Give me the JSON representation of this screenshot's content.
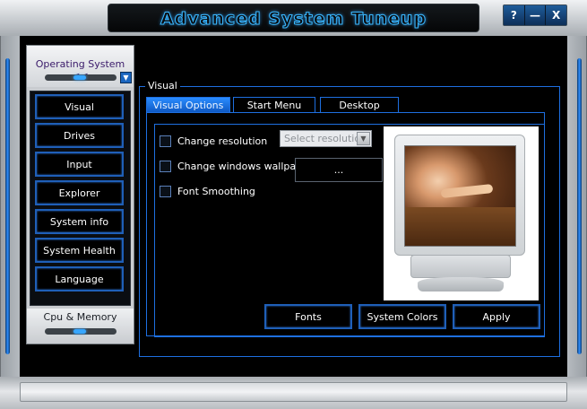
{
  "window": {
    "title": "Advanced System Tuneup",
    "controls": {
      "help": "?",
      "minimize": "—",
      "close": "X"
    }
  },
  "sidebar": {
    "header_label": "Operating System <<",
    "items": [
      {
        "label": "Visual"
      },
      {
        "label": "Drives"
      },
      {
        "label": "Input"
      },
      {
        "label": "Explorer"
      },
      {
        "label": "System info"
      },
      {
        "label": "System Health"
      },
      {
        "label": "Language"
      }
    ],
    "footer_label": "Cpu & Memory"
  },
  "main": {
    "group_title": "Visual",
    "tabs": [
      {
        "label": "Visual Options",
        "active": true
      },
      {
        "label": "Start Menu",
        "active": false
      },
      {
        "label": "Desktop",
        "active": false
      }
    ],
    "options": {
      "change_resolution": {
        "label": "Change resolution",
        "checked": false
      },
      "change_wallpaper": {
        "label": "Change windows wallpaper",
        "checked": false
      },
      "font_smoothing": {
        "label": "Font Smoothing",
        "checked": false
      }
    },
    "resolution_select": {
      "placeholder": "Select resolution"
    },
    "browse_button": "...",
    "buttons": {
      "fonts": "Fonts",
      "system_colors": "System Colors",
      "apply": "Apply"
    }
  },
  "colors": {
    "accent": "#1e6fe0",
    "background": "#000000",
    "frame": "#c9ccd0"
  }
}
